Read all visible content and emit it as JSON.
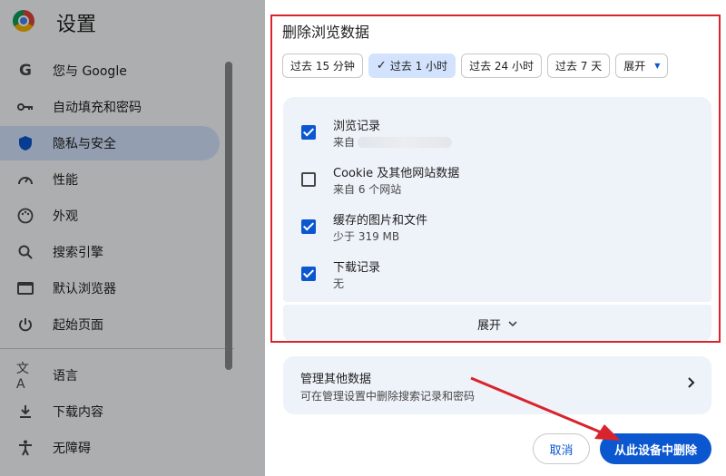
{
  "app": {
    "title": "设置"
  },
  "sidebar": {
    "items": [
      {
        "label": "您与 Google",
        "icon": "google-g-icon"
      },
      {
        "label": "自动填充和密码",
        "icon": "key-icon"
      },
      {
        "label": "隐私与安全",
        "icon": "shield-icon",
        "active": true
      },
      {
        "label": "性能",
        "icon": "speedometer-icon"
      },
      {
        "label": "外观",
        "icon": "palette-icon"
      },
      {
        "label": "搜索引擎",
        "icon": "search-icon"
      },
      {
        "label": "默认浏览器",
        "icon": "browser-window-icon"
      },
      {
        "label": "起始页面",
        "icon": "power-icon"
      },
      {
        "label": "语言",
        "icon": "translate-icon"
      },
      {
        "label": "下载内容",
        "icon": "download-icon"
      },
      {
        "label": "无障碍",
        "icon": "accessibility-icon"
      }
    ]
  },
  "dialog": {
    "title": "删除浏览数据",
    "time_ranges": [
      {
        "label": "过去 15 分钟"
      },
      {
        "label": "过去 1 小时",
        "selected": true
      },
      {
        "label": "过去 24 小时"
      },
      {
        "label": "过去 7 天"
      },
      {
        "label": "展开"
      }
    ],
    "options": [
      {
        "label": "浏览记录",
        "sub": "来自",
        "checked": true
      },
      {
        "label": "Cookie 及其他网站数据",
        "sub": "来自 6 个网站",
        "checked": false
      },
      {
        "label": "缓存的图片和文件",
        "sub": "少于 319 MB",
        "checked": true
      },
      {
        "label": "下载记录",
        "sub": "无",
        "checked": true
      }
    ],
    "expand_label": "展开",
    "manage": {
      "title": "管理其他数据",
      "subtitle": "可在管理设置中删除搜索记录和密码"
    },
    "cancel_label": "取消",
    "delete_label": "从此设备中删除"
  },
  "colors": {
    "accent": "#0b57d0",
    "selected_chip": "#d3e3fd",
    "annotation_red": "#d9232d"
  }
}
